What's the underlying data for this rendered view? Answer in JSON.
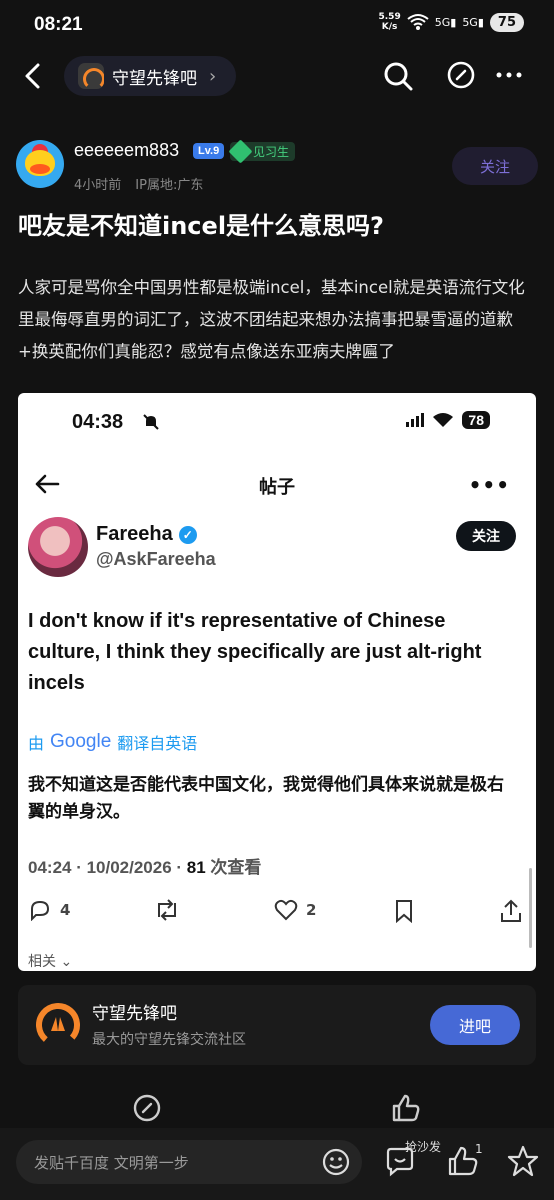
{
  "status": {
    "time": "08:21",
    "net_speed": "5.59",
    "net_unit": "K/s",
    "signal1": "5G",
    "signal2": "5G",
    "battery": "75"
  },
  "nav": {
    "forum_name": "守望先锋吧"
  },
  "author": {
    "name": "eeeeeem883",
    "level": "Lv.9",
    "role": "见习生",
    "time_ago": "4小时前",
    "ip": "IP属地:广东",
    "follow_label": "关注"
  },
  "post": {
    "title": "吧友是不知道incel是什么意思吗?",
    "body": "人家可是骂你全中国男性都是极端incel，基本incel就是英语流行文化里最侮辱直男的词汇了，这波不团结起来想办法搞事把暴雪逼的道歉+换英配你们真能忍？感觉有点像送东亚病夫牌匾了"
  },
  "shot": {
    "time": "04:38",
    "battery": "78",
    "page_title": "帖子",
    "author_name": "Fareeha",
    "handle": "@AskFareeha",
    "follow_label": "关注",
    "tweet": "I don't know if it's representative of Chinese culture, I think they specifically are just alt-right incels",
    "translate_prefix": "由",
    "translate_brand": "Google",
    "translate_suffix": "翻译自英语",
    "translation": "我不知道这是否能代表中国文化，我觉得他们具体来说就是极右翼的单身汉。",
    "meta_time": "04:24 · 10/02/2026 · ",
    "views": "81",
    "views_label": " 次查看",
    "replies": "4",
    "likes": "2",
    "related": "相关"
  },
  "forum_card": {
    "name": "守望先锋吧",
    "desc": "最大的守望先锋交流社区",
    "join_label": "进吧"
  },
  "bottom": {
    "reply_placeholder": "发贴千百度 文明第一步",
    "sofa_label": "抢沙发",
    "like_count": "1"
  },
  "colors": {
    "accent": "#4669d6",
    "follow_text": "#7d6fd6",
    "overwatch_orange": "#f5862a",
    "twitter_blue": "#1d9bf0"
  }
}
